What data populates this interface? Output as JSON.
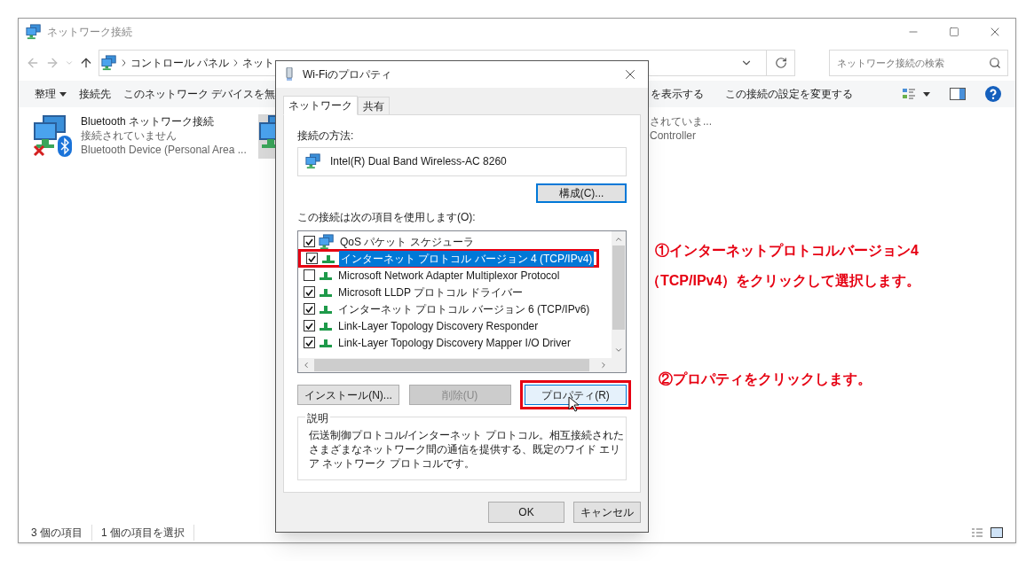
{
  "explorer": {
    "title": "ネットワーク接続",
    "breadcrumb": [
      "コントロール パネル",
      "ネット"
    ],
    "search": {
      "placeholder": "ネットワーク接続の検索"
    },
    "toolbar_left": [
      {
        "label": "整理",
        "dropdown": true
      },
      {
        "label": "接続先",
        "dropdown": false
      },
      {
        "label": "このネットワーク デバイスを無",
        "dropdown": false
      }
    ],
    "toolbar_right": [
      "を表示する",
      "この接続の設定を変更する"
    ],
    "items": [
      {
        "name": "Bluetooth ネットワーク接続",
        "status": "接続されていません",
        "device": "Bluetooth Device (Personal Area ...",
        "disconnected": true,
        "selected": false
      },
      {
        "status": "されていま...",
        "device": "Controller",
        "disconnected": false,
        "selected": true
      }
    ],
    "status_bar": [
      "3 個の項目",
      "1 個の項目を選択"
    ]
  },
  "dialog": {
    "title": "Wi-Fiのプロパティ",
    "tabs": [
      {
        "label": "ネットワーク",
        "selected": true
      },
      {
        "label": "共有",
        "selected": false
      }
    ],
    "connect_using_label": "接続の方法:",
    "adapter": "Intel(R) Dual Band Wireless-AC 8260",
    "configure_button": "構成(C)...",
    "components_label": "この接続は次の項目を使用します(O):",
    "components": [
      {
        "label": "QoS パケット スケジューラ",
        "kind": "service",
        "checked": true,
        "selected": false,
        "marked": false
      },
      {
        "label": "インターネット プロトコル バージョン 4 (TCP/IPv4)",
        "kind": "protocol",
        "checked": true,
        "selected": true,
        "marked": true
      },
      {
        "label": "Microsoft Network Adapter Multiplexor Protocol",
        "kind": "protocol",
        "checked": false,
        "selected": false,
        "marked": false
      },
      {
        "label": "Microsoft LLDP プロトコル ドライバー",
        "kind": "protocol",
        "checked": true,
        "selected": false,
        "marked": false
      },
      {
        "label": "インターネット プロトコル バージョン 6 (TCP/IPv6)",
        "kind": "protocol",
        "checked": true,
        "selected": false,
        "marked": false
      },
      {
        "label": "Link-Layer Topology Discovery Responder",
        "kind": "protocol",
        "checked": true,
        "selected": false,
        "marked": false
      },
      {
        "label": "Link-Layer Topology Discovery Mapper I/O Driver",
        "kind": "protocol",
        "checked": true,
        "selected": false,
        "marked": false
      }
    ],
    "buttons": [
      {
        "label": "インストール(N)...",
        "disabled": false,
        "focused": false,
        "marked": false
      },
      {
        "label": "削除(U)",
        "disabled": true,
        "focused": false,
        "marked": false
      },
      {
        "label": "プロパティ(R)",
        "disabled": false,
        "focused": true,
        "marked": true
      }
    ],
    "description_label": "説明",
    "description": "伝送制御プロトコル/インターネット プロトコル。相互接続されたさまざまなネットワーク間の通信を提供する、既定のワイド エリア ネットワーク プロトコルです。",
    "ok": "OK",
    "cancel": "キャンセル"
  },
  "annotations": [
    {
      "line1": "①インターネットプロトコルバージョン4",
      "line2": "（TCP/IPv4）をクリックして選択します。"
    },
    {
      "line1": "②プロパティをクリックします。"
    }
  ]
}
